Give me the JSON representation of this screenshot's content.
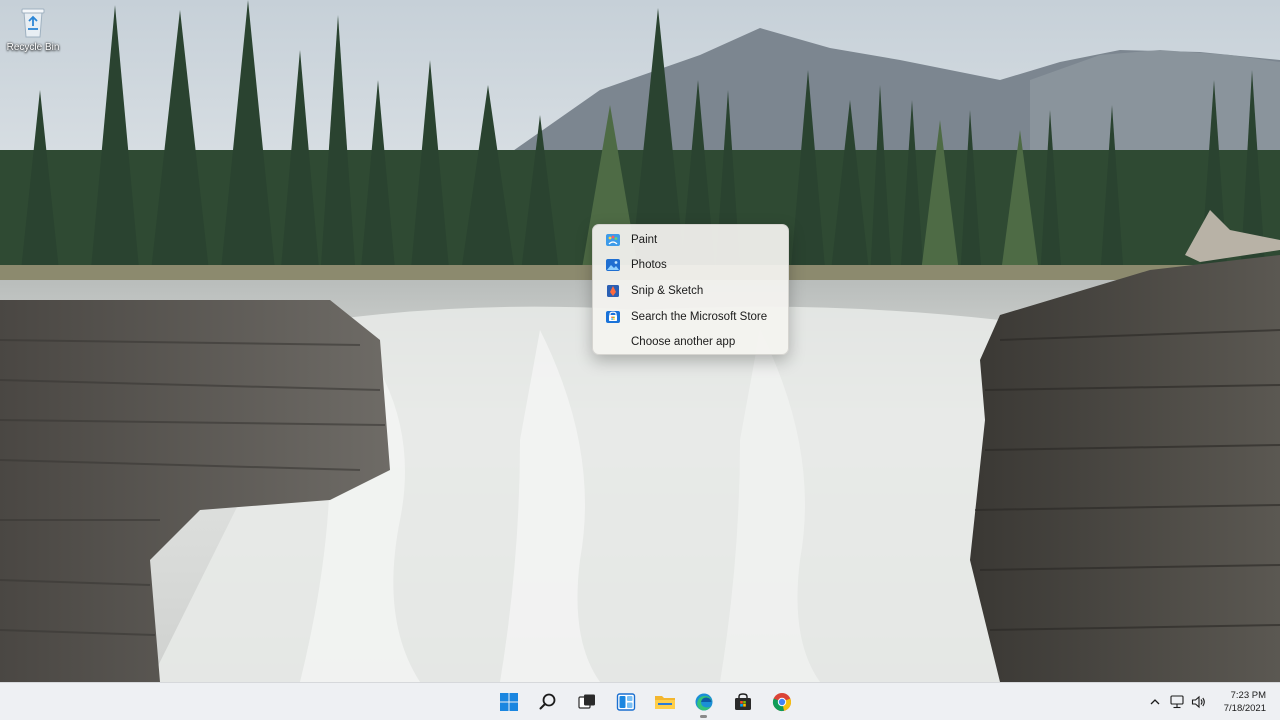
{
  "desktop": {
    "icons": [
      {
        "label": "Recycle Bin",
        "icon": "recycle-bin-icon"
      }
    ]
  },
  "open_with_menu": {
    "items": [
      {
        "label": "Paint",
        "icon": "paint-icon"
      },
      {
        "label": "Photos",
        "icon": "photos-icon"
      },
      {
        "label": "Snip & Sketch",
        "icon": "snip-sketch-icon"
      },
      {
        "label": "Search the Microsoft Store",
        "icon": "microsoft-store-icon"
      },
      {
        "label": "Choose another app",
        "icon": ""
      }
    ]
  },
  "taskbar": {
    "apps": [
      {
        "name": "Start",
        "icon": "windows-start-icon"
      },
      {
        "name": "Search",
        "icon": "search-icon"
      },
      {
        "name": "Task View",
        "icon": "task-view-icon"
      },
      {
        "name": "Widgets",
        "icon": "widgets-icon"
      },
      {
        "name": "File Explorer",
        "icon": "file-explorer-icon"
      },
      {
        "name": "Microsoft Edge",
        "icon": "edge-icon"
      },
      {
        "name": "Microsoft Store",
        "icon": "store-icon"
      },
      {
        "name": "Google Chrome",
        "icon": "chrome-icon"
      }
    ],
    "tray": {
      "icons": [
        "chevron-up-icon",
        "network-icon",
        "volume-icon"
      ],
      "time": "7:23 PM",
      "date": "7/18/2021"
    }
  },
  "colors": {
    "accent": "#0067c0",
    "taskbar_bg": "#eef0f3",
    "menu_bg": "#f4f3f0"
  }
}
